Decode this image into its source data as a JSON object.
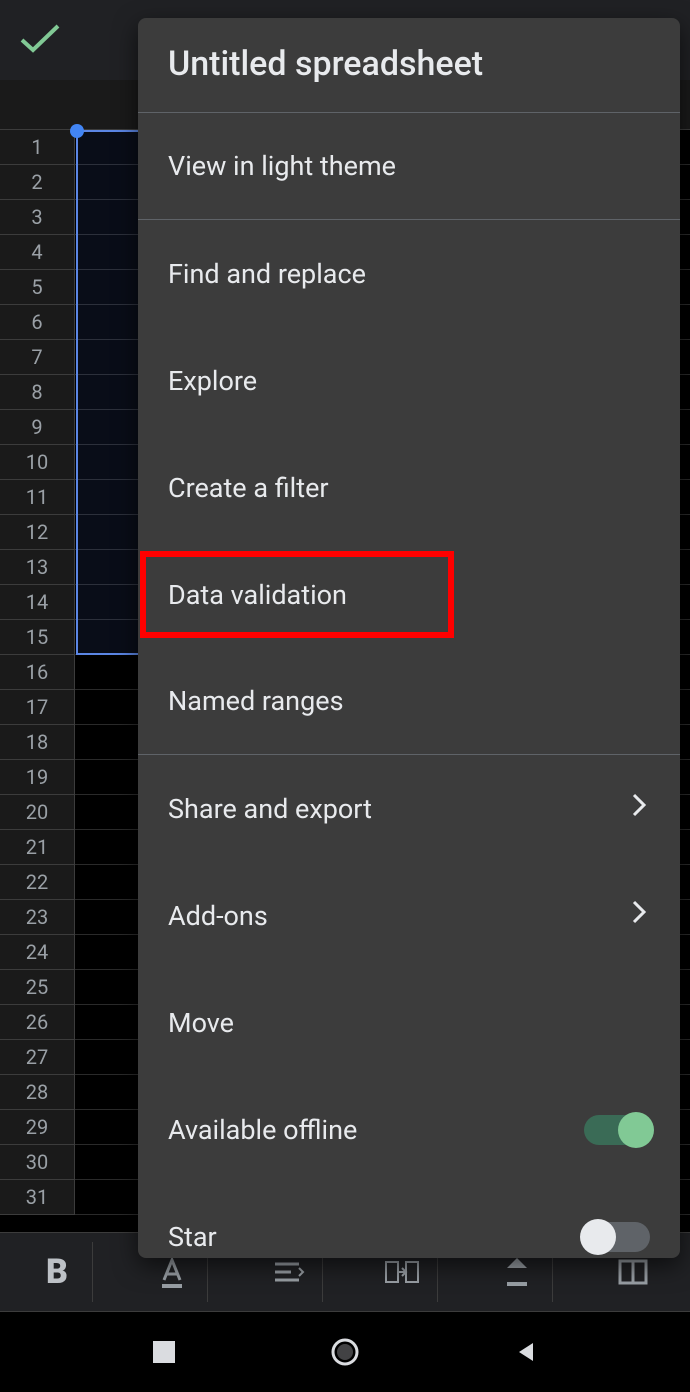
{
  "title": "Untitled spreadsheet",
  "menu": {
    "items": [
      {
        "label": "View in light theme",
        "sep_after": true,
        "chevron": false,
        "toggle": null
      },
      {
        "label": "Find and replace",
        "sep_after": false,
        "chevron": false,
        "toggle": null
      },
      {
        "label": "Explore",
        "sep_after": false,
        "chevron": false,
        "toggle": null
      },
      {
        "label": "Create a filter",
        "sep_after": false,
        "chevron": false,
        "toggle": null
      },
      {
        "label": "Data validation",
        "sep_after": false,
        "chevron": false,
        "toggle": null,
        "highlighted": true
      },
      {
        "label": "Named ranges",
        "sep_after": true,
        "chevron": false,
        "toggle": null
      },
      {
        "label": "Share and export",
        "sep_after": false,
        "chevron": true,
        "toggle": null
      },
      {
        "label": "Add-ons",
        "sep_after": false,
        "chevron": true,
        "toggle": null
      },
      {
        "label": "Move",
        "sep_after": false,
        "chevron": false,
        "toggle": null
      },
      {
        "label": "Available offline",
        "sep_after": false,
        "chevron": false,
        "toggle": "on"
      },
      {
        "label": "Star",
        "sep_after": false,
        "chevron": false,
        "toggle": "off"
      }
    ]
  },
  "rows": [
    "1",
    "2",
    "3",
    "4",
    "5",
    "6",
    "7",
    "8",
    "9",
    "10",
    "11",
    "12",
    "13",
    "14",
    "15",
    "16",
    "17",
    "18",
    "19",
    "20",
    "21",
    "22",
    "23",
    "24",
    "25",
    "26",
    "27",
    "28",
    "29",
    "30",
    "31"
  ],
  "toolbar": {
    "bold": "B"
  }
}
